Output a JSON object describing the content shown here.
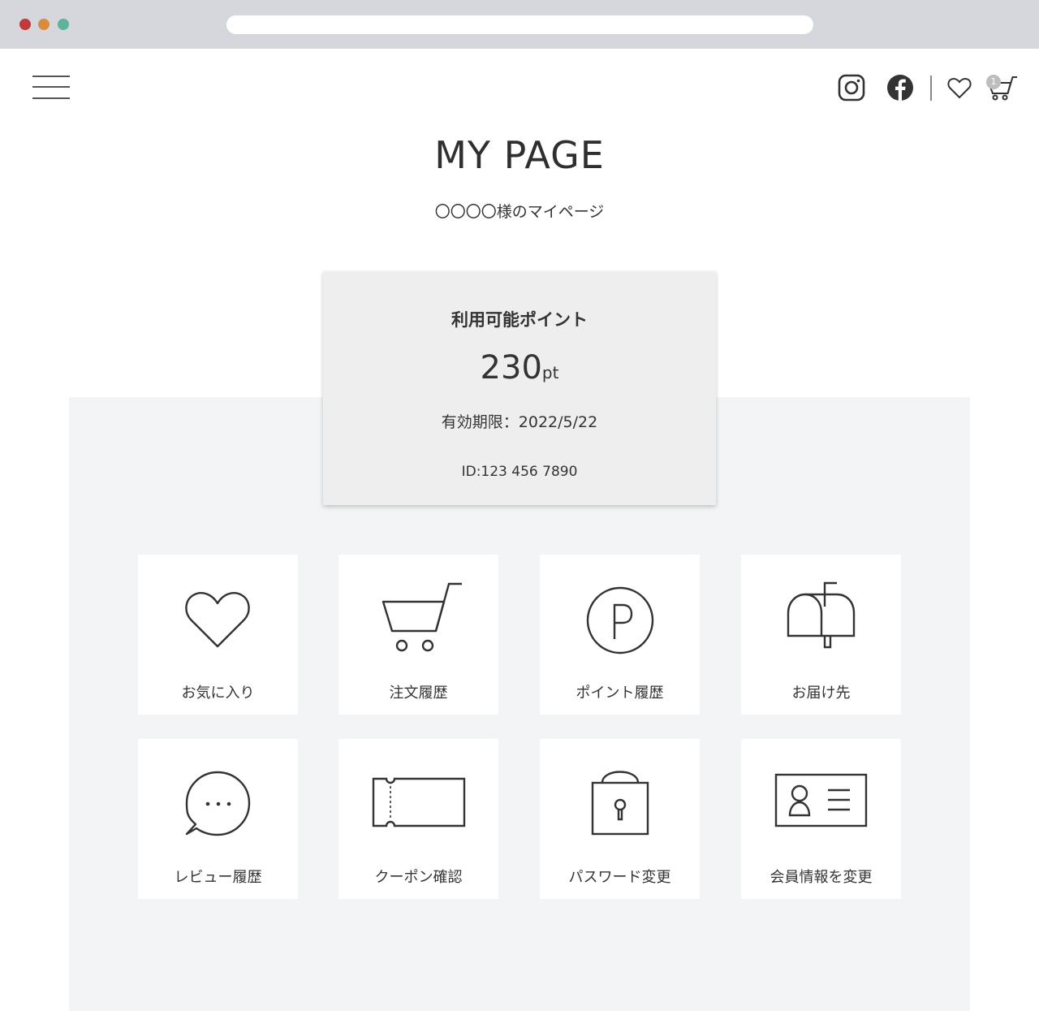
{
  "header": {
    "menu_icon": "hamburger-icon",
    "social_icons": [
      "instagram-icon",
      "facebook-icon"
    ],
    "favorite_icon": "heart-icon",
    "cart_icon": "cart-icon",
    "cart_count": "1"
  },
  "page": {
    "title": "MY PAGE",
    "subtitle": "〇〇〇〇様のマイページ"
  },
  "points": {
    "label": "利用可能ポイント",
    "value": "230",
    "unit": "pt",
    "expiry_label": "有効期限：",
    "expiry_date": "2022/5/22",
    "member_id": "ID:123 456 7890"
  },
  "menu": [
    {
      "label": "お気に入り",
      "icon": "heart-icon"
    },
    {
      "label": "注文履歴",
      "icon": "cart-icon"
    },
    {
      "label": "ポイント履歴",
      "icon": "point-icon"
    },
    {
      "label": "お届け先",
      "icon": "mailbox-icon"
    },
    {
      "label": "レビュー履歴",
      "icon": "speech-bubble-icon"
    },
    {
      "label": "クーポン確認",
      "icon": "ticket-icon"
    },
    {
      "label": "パスワード変更",
      "icon": "lock-icon"
    },
    {
      "label": "会員情報を変更",
      "icon": "id-card-icon"
    }
  ],
  "colors": {
    "chrome": "#d5d7dc",
    "panel": "#f3f4f6",
    "card": "#eeeeee",
    "text": "#333333",
    "dot_red": "#c0393b",
    "dot_orange": "#d98c3b",
    "dot_green": "#5db49b"
  }
}
